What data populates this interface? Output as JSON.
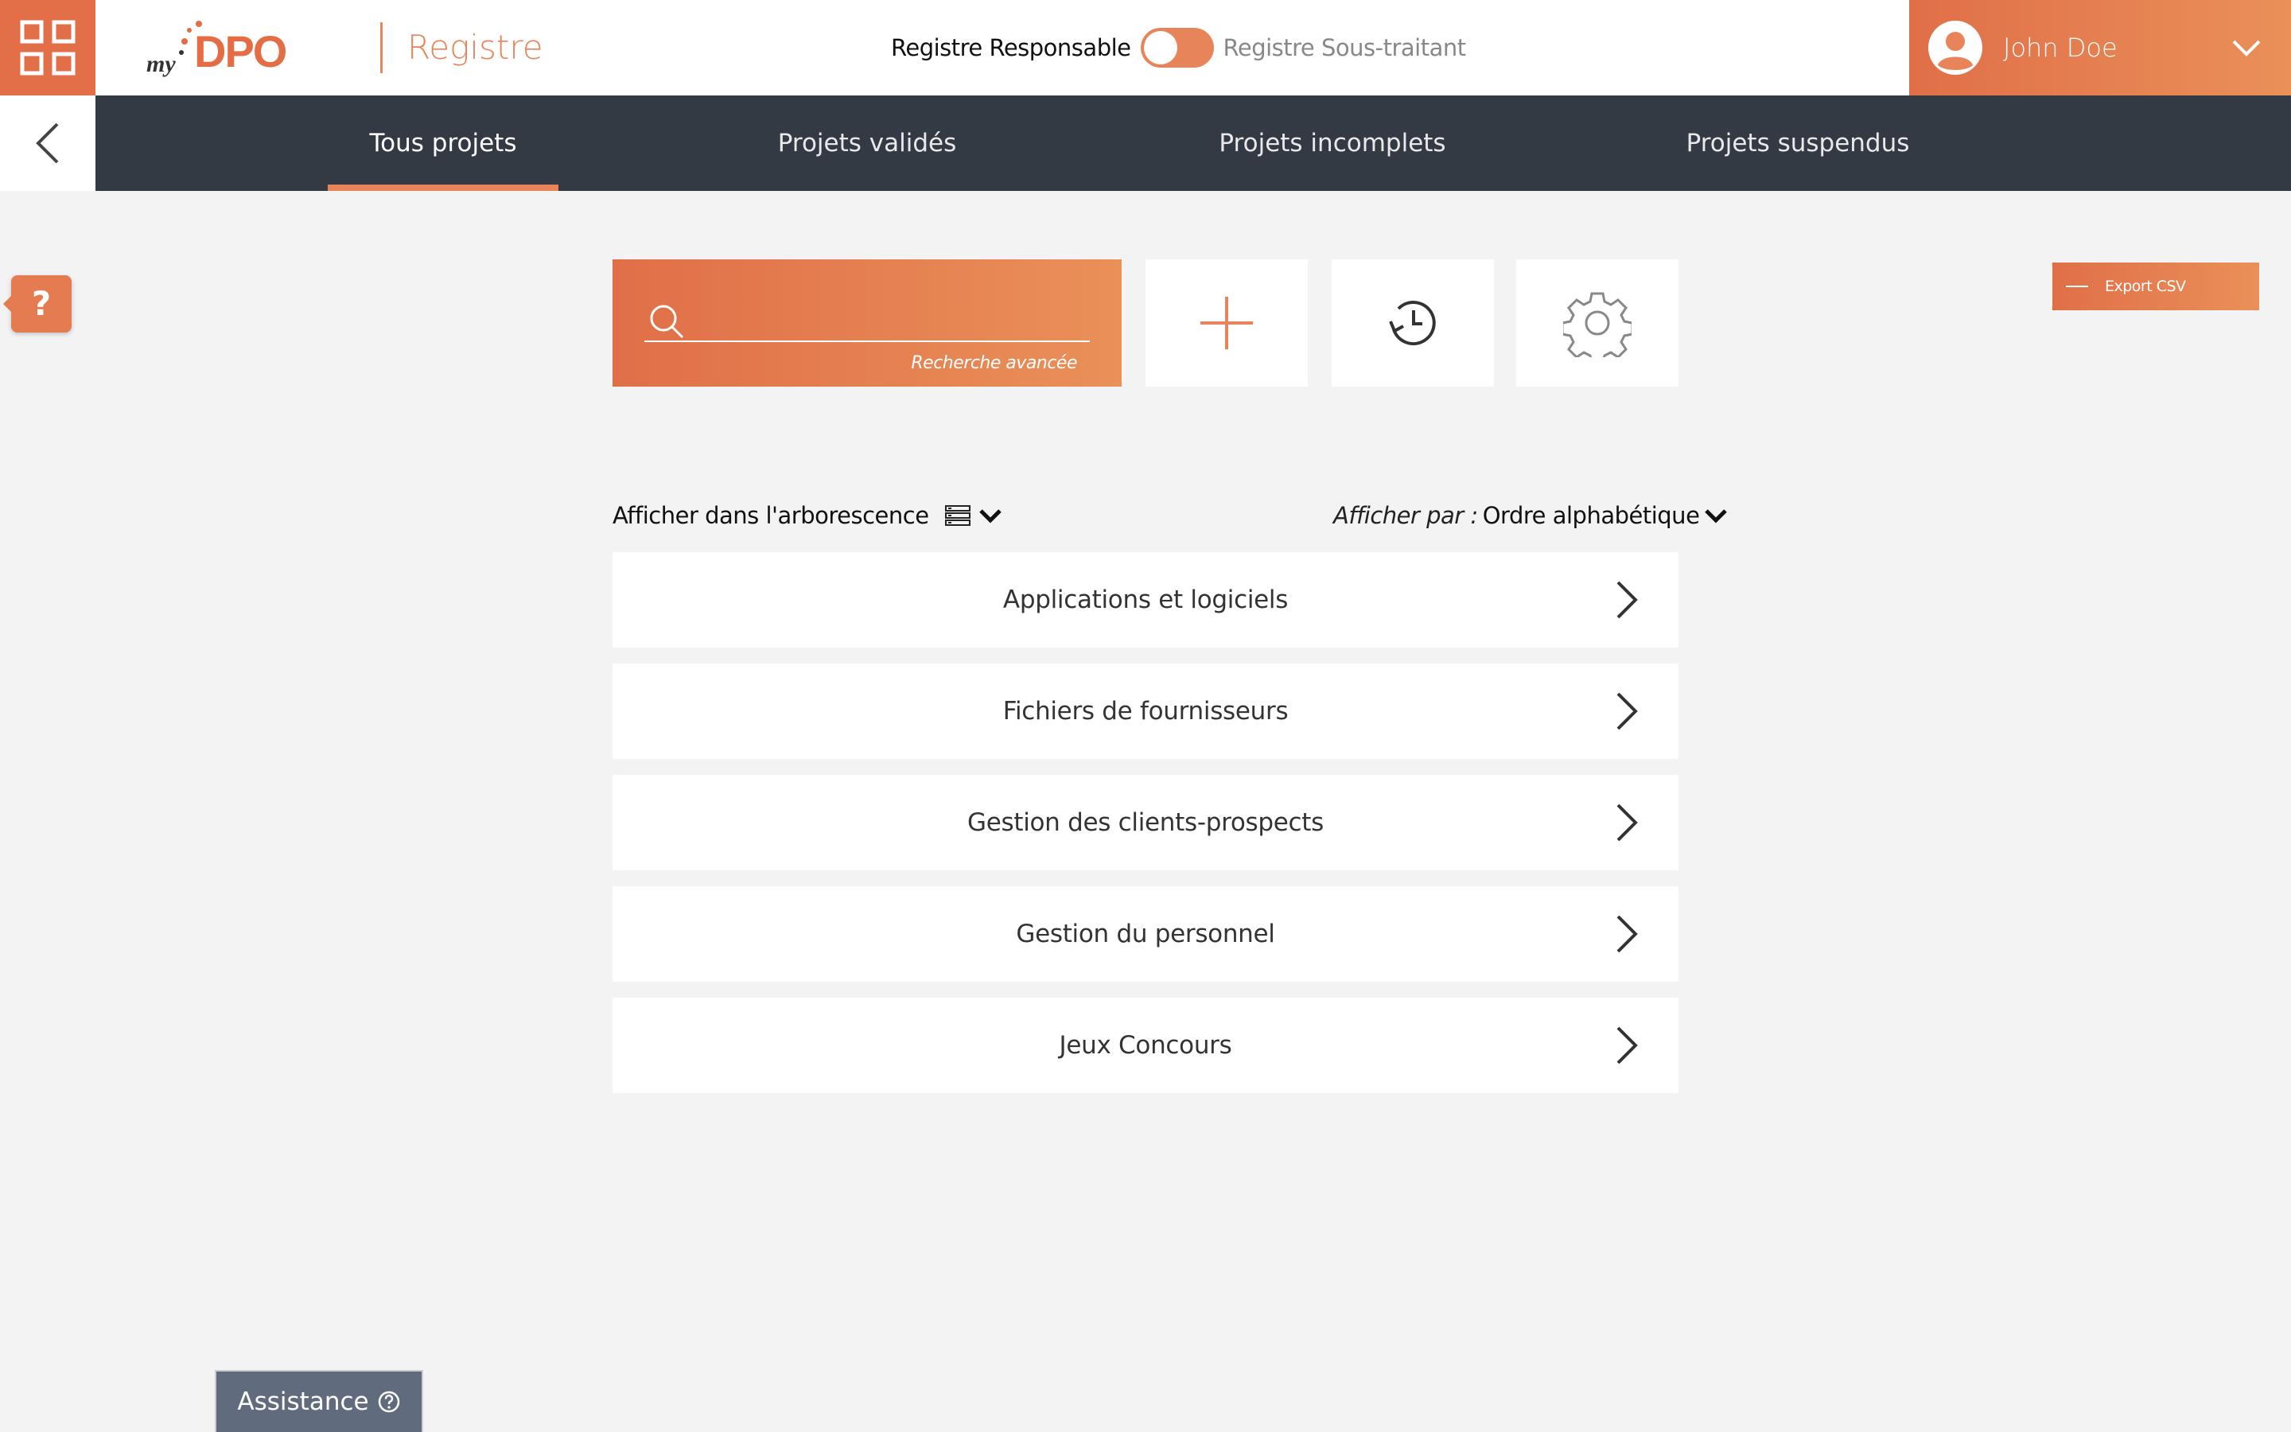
{
  "header": {
    "logo_my": "my",
    "logo_dpo": "DPO",
    "title": "Registre",
    "toggle": {
      "left_label": "Registre Responsable",
      "right_label": "Registre Sous-traitant"
    },
    "user": {
      "name": "John Doe"
    }
  },
  "nav": {
    "tabs": [
      {
        "label": "Tous projets",
        "active": true
      },
      {
        "label": "Projets validés",
        "active": false
      },
      {
        "label": "Projets incomplets",
        "active": false
      },
      {
        "label": "Projets suspendus",
        "active": false
      }
    ]
  },
  "help": {
    "label": "?"
  },
  "export": {
    "label": "Export CSV"
  },
  "search": {
    "value": "",
    "advanced_label": "Recherche avancée"
  },
  "toolbar": {
    "icons": [
      "plus-icon",
      "history-icon",
      "gear-icon"
    ]
  },
  "filters": {
    "tree_label": "Afficher dans l'arborescence",
    "sort_prefix": "Afficher par :",
    "sort_value": "Ordre alphabétique"
  },
  "projects": [
    {
      "name": "Applications et logiciels"
    },
    {
      "name": "Fichiers de fournisseurs"
    },
    {
      "name": "Gestion des clients-prospects"
    },
    {
      "name": "Gestion du personnel"
    },
    {
      "name": "Jeux Concours"
    }
  ],
  "assistance": {
    "label": "Assistance"
  },
  "colors": {
    "accent": "#e8845a",
    "nav_bg": "#343a44",
    "page_bg": "#f3f3f3",
    "assist_bg": "#616b7e"
  }
}
